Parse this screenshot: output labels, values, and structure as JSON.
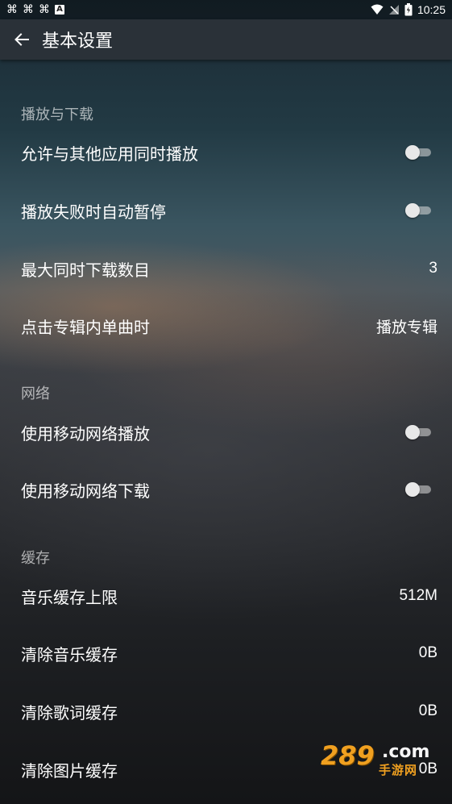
{
  "status_bar": {
    "time": "10:25",
    "left_icons": [
      "notification-icon",
      "notification-icon",
      "notification-icon",
      "a-icon"
    ],
    "right_icons": [
      "wifi-icon",
      "no-signal-icon",
      "battery-icon"
    ]
  },
  "header": {
    "title": "基本设置",
    "back_icon": "arrow-left-icon"
  },
  "sections": [
    {
      "title": "播放与下载",
      "items": [
        {
          "label": "允许与其他应用同时播放",
          "type": "toggle",
          "checked": false
        },
        {
          "label": "播放失败时自动暂停",
          "type": "toggle",
          "checked": false
        },
        {
          "label": "最大同时下载数目",
          "type": "value",
          "value": "3"
        },
        {
          "label": "点击专辑内单曲时",
          "type": "value",
          "value": "播放专辑"
        }
      ]
    },
    {
      "title": "网络",
      "items": [
        {
          "label": "使用移动网络播放",
          "type": "toggle",
          "checked": false
        },
        {
          "label": "使用移动网络下载",
          "type": "toggle",
          "checked": false
        }
      ]
    },
    {
      "title": "缓存",
      "items": [
        {
          "label": "音乐缓存上限",
          "type": "value",
          "value": "512M"
        },
        {
          "label": "清除音乐缓存",
          "type": "value",
          "value": "0B"
        },
        {
          "label": "清除歌词缓存",
          "type": "value",
          "value": "0B"
        },
        {
          "label": "清除图片缓存",
          "type": "value",
          "value": "0B"
        }
      ]
    }
  ],
  "watermark": {
    "number": "289",
    "domain": ".com",
    "subtitle": "手游网"
  },
  "colors": {
    "app_bar": "#2a3138",
    "toggle_track": "#c8c8c8",
    "toggle_thumb": "#e8e8e8",
    "watermark_accent": "#f0a020"
  }
}
